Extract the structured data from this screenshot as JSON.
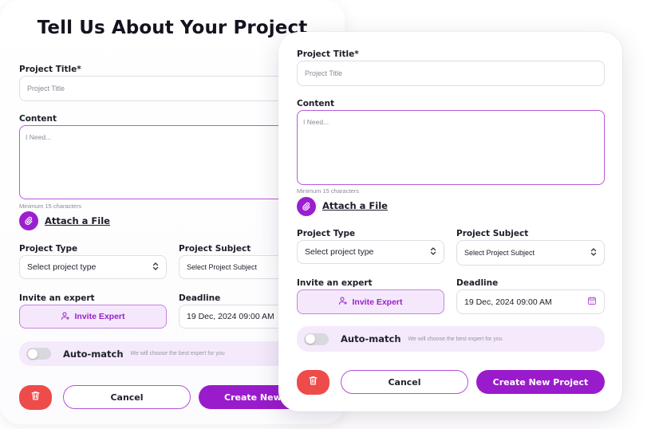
{
  "title": "Tell Us About Your Project",
  "form": {
    "project_title_label": "Project Title*",
    "project_title_placeholder": "Project Title",
    "content_label": "Content",
    "content_placeholder": "I Need...",
    "content_hint": "Minimum 15 characters",
    "attach_label": "Attach a File",
    "project_type_label": "Project Type",
    "project_type_value": "Select project type",
    "project_subject_label": "Project Subject",
    "project_subject_value": "Select Project Subject",
    "invite_label": "Invite an expert",
    "invite_button": "Invite Expert",
    "deadline_label": "Deadline",
    "deadline_value": "19 Dec, 2024 09:00 AM",
    "automatch_label": "Auto-match",
    "automatch_desc": "We will choose the best expert for you",
    "cancel_label": "Cancel",
    "create_label": "Create New Project",
    "create_label_cut": "Create New Pr"
  },
  "icons": {
    "attach": "paperclip-icon",
    "select": "chevron-updown-icon",
    "invite": "user-plus-icon",
    "deadline": "calendar-icon",
    "delete": "trash-icon"
  },
  "colors": {
    "primary": "#9a1bcc",
    "primary_light": "#f5e8fc",
    "border_focus": "#b85ad9",
    "danger": "#ee4b4b",
    "toggle_off": "#d9d8de"
  }
}
